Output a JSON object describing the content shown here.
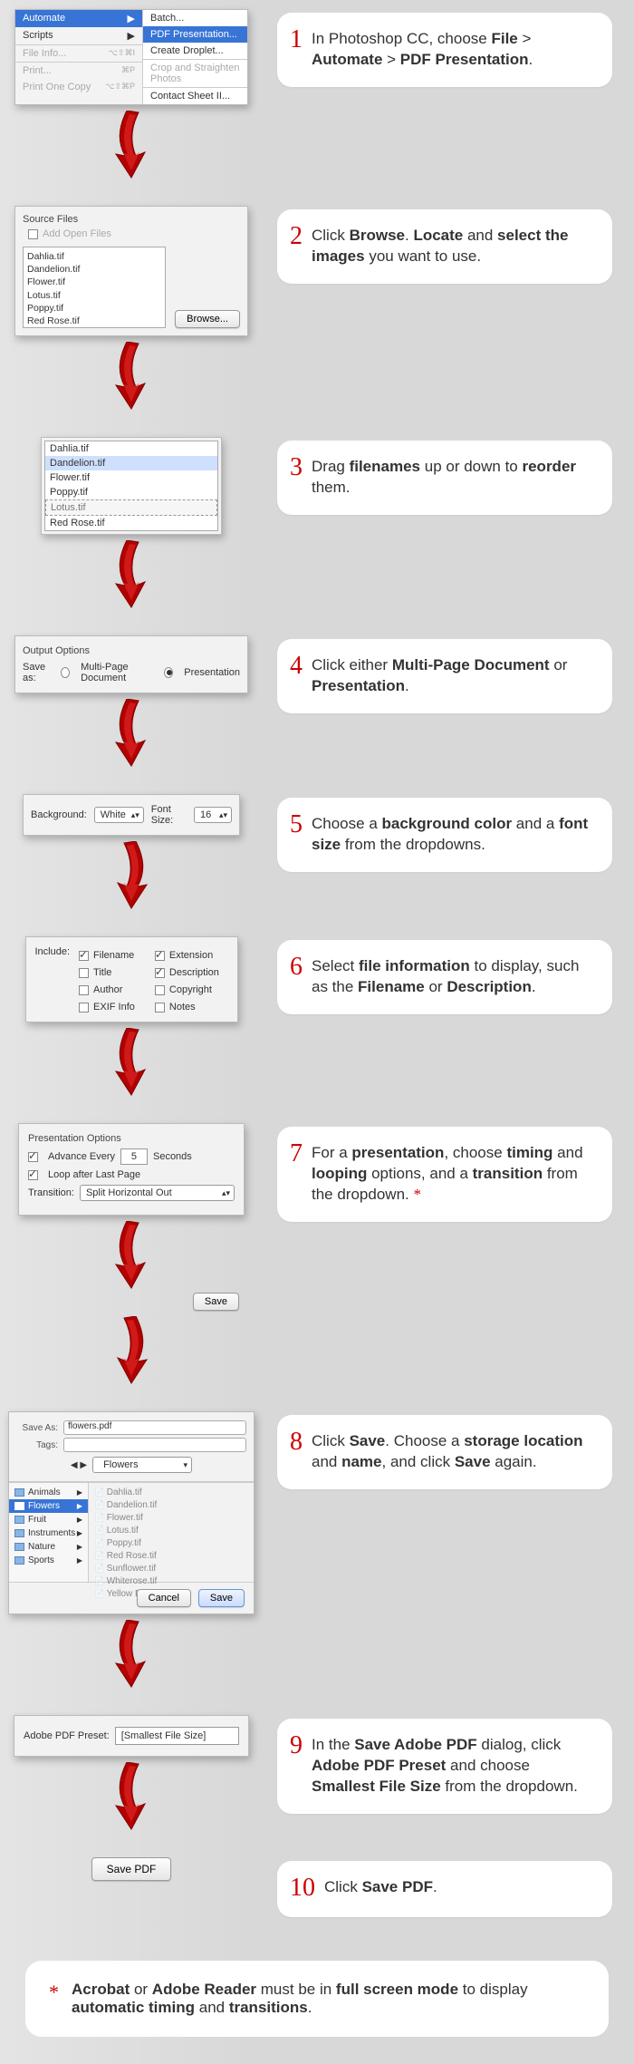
{
  "steps": [
    {
      "num": "1",
      "text_pre": "In Photoshop CC, choose ",
      "b1": "File",
      "mid1": " > ",
      "b2": "Automate",
      "mid2": " > ",
      "b3": "PDF Presentation",
      "post": "."
    },
    {
      "num": "2",
      "text": "Click ",
      "b1": "Browse",
      "mid1": ". ",
      "b2": "Locate",
      "mid2": " and ",
      "b3": "select the images",
      "post": " you want to use."
    },
    {
      "num": "3",
      "text": "Drag ",
      "b1": "filenames",
      "mid1": " up or down to ",
      "b2": "reorder",
      "post": " them."
    },
    {
      "num": "4",
      "text": "Click either ",
      "b1": "Multi-Page Document",
      "mid1": " or ",
      "b2": "Presentation",
      "post": "."
    },
    {
      "num": "5",
      "text": "Choose a ",
      "b1": "background color",
      "mid1": " and a ",
      "b2": "font size",
      "post": " from the dropdowns."
    },
    {
      "num": "6",
      "text": "Select ",
      "b1": "file information",
      "mid1": " to display, such as the ",
      "b2": "Filename",
      "mid2": " or ",
      "b3": "Description",
      "post": "."
    },
    {
      "num": "7",
      "text": "For a ",
      "b1": "presentation",
      "mid1": ", choose ",
      "b2": "timing",
      "mid2": " and ",
      "b3": "looping",
      "mid3": " options, and a ",
      "b4": "transition",
      "post": " from the dropdown. ",
      "ast": "*"
    },
    {
      "num": "8",
      "text": "Click ",
      "b1": "Save",
      "mid1": ". Choose a ",
      "b2": "storage location",
      "mid2": " and ",
      "b3": "name",
      "post": ", and click ",
      "b4": "Save",
      "post2": " again."
    },
    {
      "num": "9",
      "text": "In the ",
      "b1": "Save Adobe PDF",
      "mid1": " dialog, click ",
      "b2": "Adobe PDF Preset",
      "mid2": " and choose ",
      "b3": "Smallest File Size",
      "post": " from the dropdown."
    },
    {
      "num": "10",
      "text": "Click ",
      "b1": "Save PDF",
      "post": "."
    }
  ],
  "menu": {
    "left": [
      {
        "label": "Automate",
        "arrow": "▶",
        "hl": true
      },
      {
        "label": "Scripts",
        "arrow": "▶"
      },
      {
        "label": "File Info...",
        "shortcut": "⌥⇧⌘I",
        "dis": true,
        "sep": true
      },
      {
        "label": "Print...",
        "shortcut": "⌘P",
        "dis": true,
        "sep": true
      },
      {
        "label": "Print One Copy",
        "shortcut": "⌥⇧⌘P",
        "dis": true
      }
    ],
    "right": [
      {
        "label": "Batch..."
      },
      {
        "label": "PDF Presentation...",
        "hl": true
      },
      {
        "label": "Create Droplet..."
      },
      {
        "label": "Crop and Straighten Photos",
        "sep": true,
        "dis": true
      },
      {
        "label": "Contact Sheet II...",
        "sep": true
      }
    ]
  },
  "sourceFiles": {
    "title": "Source Files",
    "addOpen": "Add Open Files",
    "files": [
      "Dahlia.tif",
      "Dandelion.tif",
      "Flower.tif",
      "Lotus.tif",
      "Poppy.tif",
      "Red Rose.tif"
    ],
    "browse": "Browse..."
  },
  "reorder": [
    "Dahlia.tif",
    "Dandelion.tif",
    "Flower.tif",
    "Poppy.tif",
    "Lotus.tif",
    "Red Rose.tif"
  ],
  "reorder_selected": "Dandelion.tif",
  "reorder_dragging": "Lotus.tif",
  "output": {
    "title": "Output Options",
    "saveAs": "Save as:",
    "opt1": "Multi-Page Document",
    "opt2": "Presentation"
  },
  "bgfont": {
    "bgLabel": "Background:",
    "bgValue": "White",
    "fsLabel": "Font Size:",
    "fsValue": "16"
  },
  "include": {
    "label": "Include:",
    "opts": [
      {
        "label": "Filename",
        "on": true
      },
      {
        "label": "Extension",
        "on": true
      },
      {
        "label": "Title",
        "on": false
      },
      {
        "label": "Description",
        "on": true
      },
      {
        "label": "Author",
        "on": false
      },
      {
        "label": "Copyright",
        "on": false
      },
      {
        "label": "EXIF Info",
        "on": false
      },
      {
        "label": "Notes",
        "on": false
      }
    ]
  },
  "pres": {
    "title": "Presentation Options",
    "advance": "Advance Every",
    "seconds": "Seconds",
    "advVal": "5",
    "loop": "Loop after Last Page",
    "trans": "Transition:",
    "transVal": "Split Horizontal Out"
  },
  "saveBtn": "Save",
  "saveDialog": {
    "saveAs": "Save As:",
    "saveAsVal": "flowers.pdf",
    "tags": "Tags:",
    "loc": "Flowers",
    "sidebar": [
      "Animals",
      "Flowers",
      "Fruit",
      "Instruments",
      "Nature",
      "Sports"
    ],
    "sidebarSel": "Flowers",
    "files": [
      "Dahlia.tif",
      "Dandelion.tif",
      "Flower.tif",
      "Lotus.tif",
      "Poppy.tif",
      "Red Rose.tif",
      "Sunflower.tif",
      "Whiterose.tif",
      "Yellow Daisy.tif"
    ],
    "cancel": "Cancel",
    "save": "Save"
  },
  "preset": {
    "label": "Adobe PDF Preset:",
    "value": "[Smallest File Size]"
  },
  "savePdf": "Save PDF",
  "footnote": {
    "ast": "*",
    "pre": "",
    "b1": "Acrobat",
    "mid1": " or ",
    "b2": "Adobe Reader",
    "mid2": " must be in ",
    "b3": "full screen mode",
    "mid3": " to display ",
    "b4": "automatic timing",
    "mid4": " and ",
    "b5": "transitions",
    "post": "."
  }
}
